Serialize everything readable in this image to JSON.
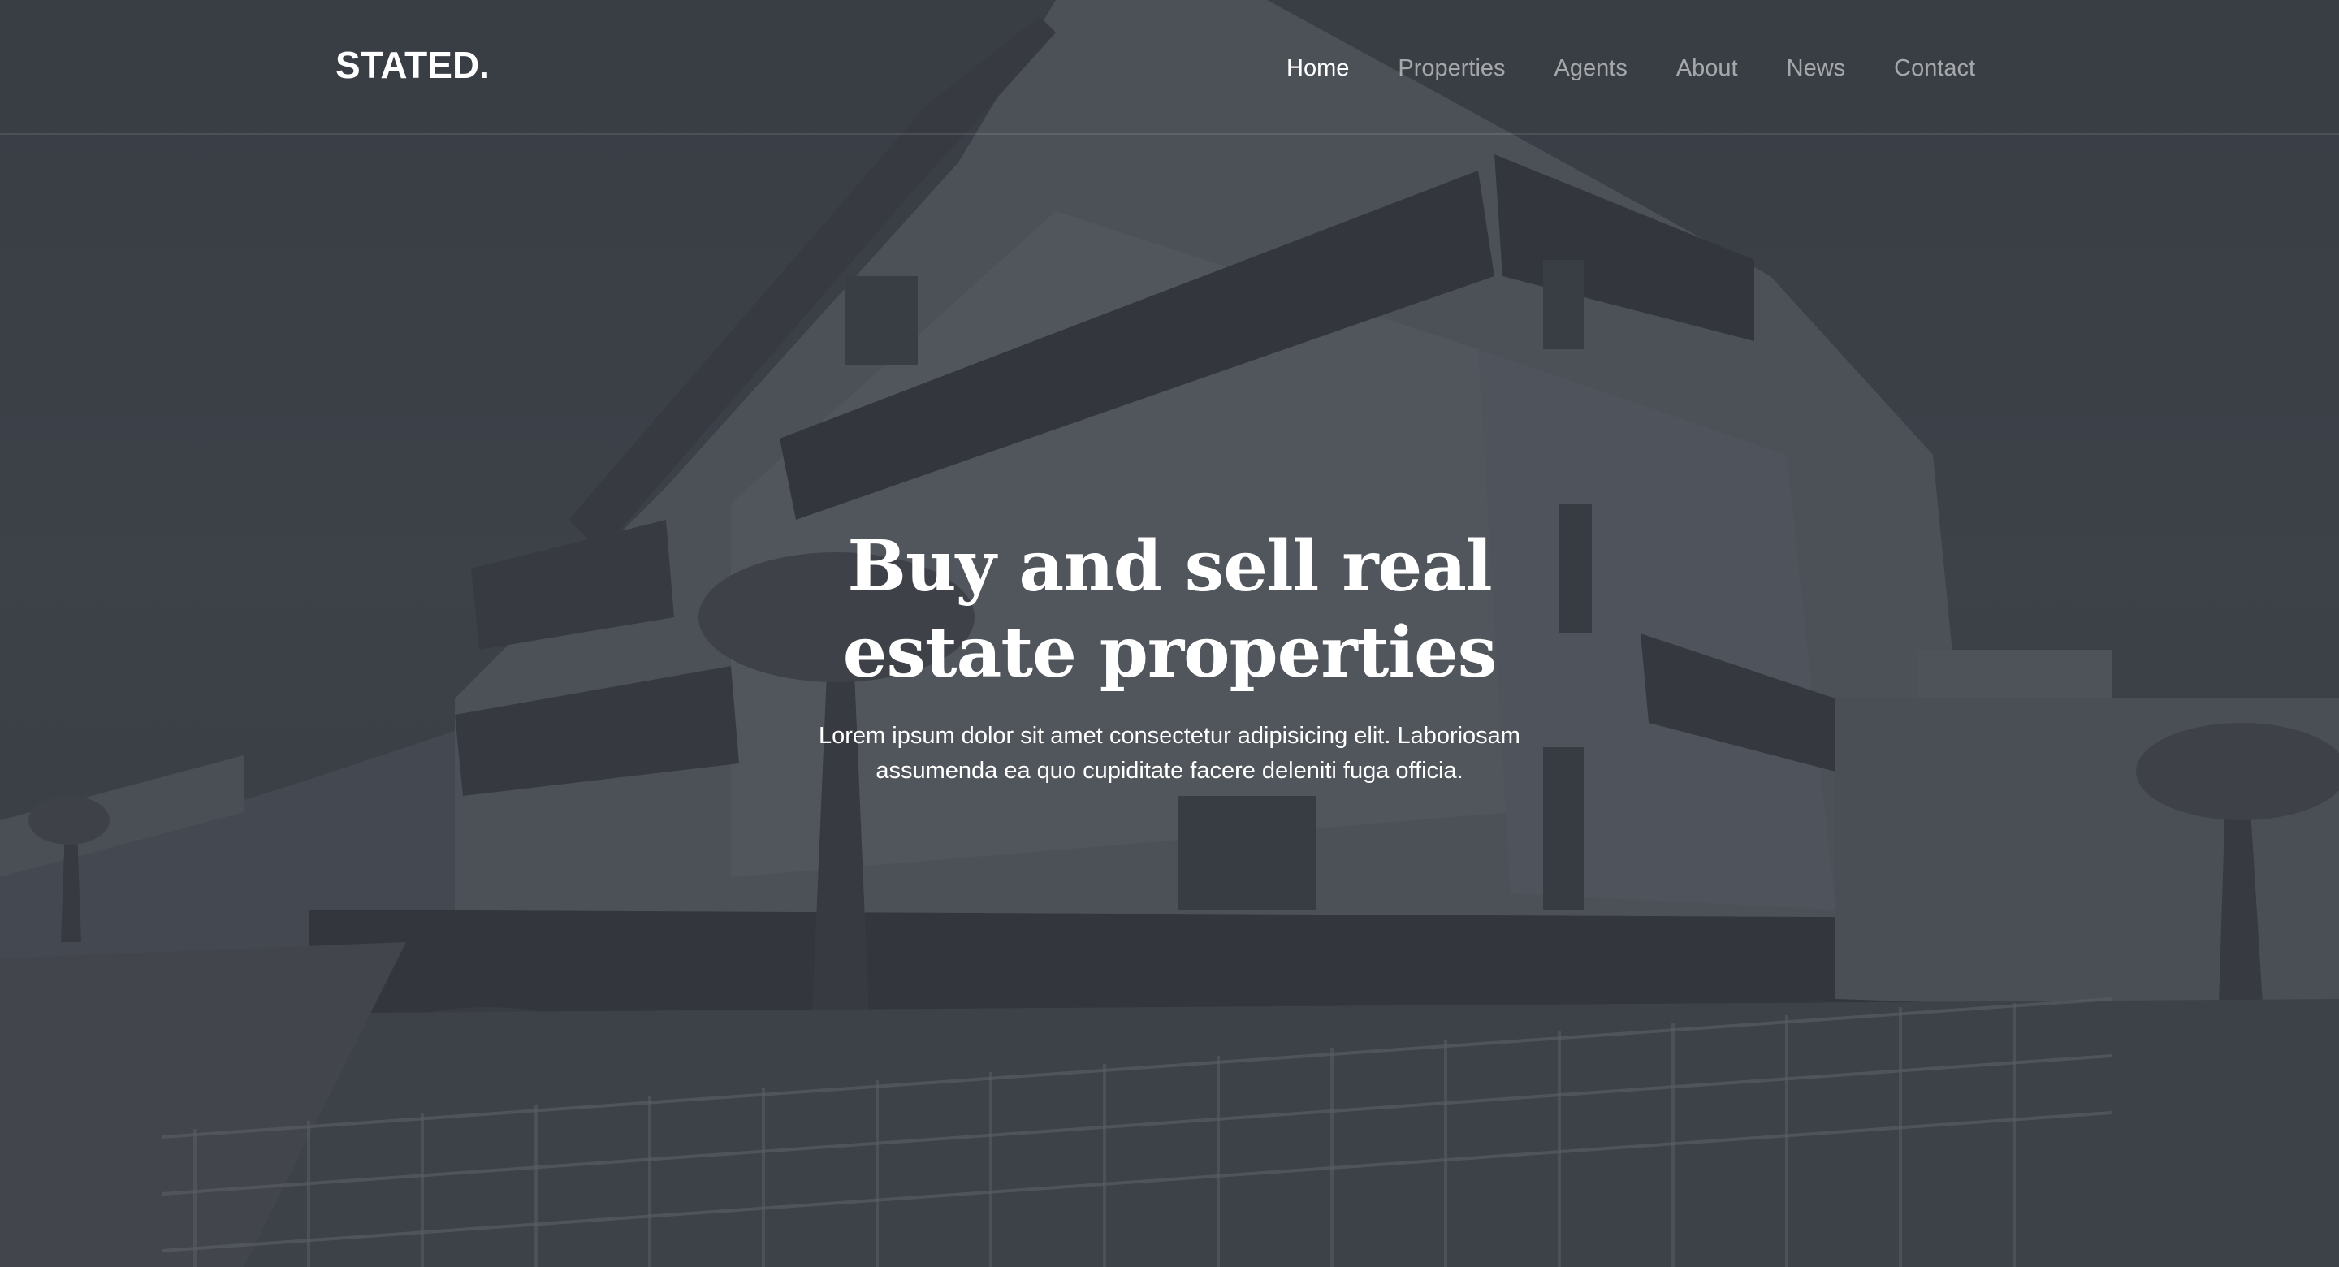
{
  "brand": {
    "logo": "STATED."
  },
  "nav": {
    "items": [
      {
        "label": "Home",
        "active": true
      },
      {
        "label": "Properties",
        "active": false
      },
      {
        "label": "Agents",
        "active": false
      },
      {
        "label": "About",
        "active": false
      },
      {
        "label": "News",
        "active": false
      },
      {
        "label": "Contact",
        "active": false
      }
    ]
  },
  "hero": {
    "title": "Buy and sell real estate properties",
    "subtitle": "Lorem ipsum dolor sit amet consectetur adipisicing elit. Laboriosam assumenda ea quo cupiditate facere deleniti fuga officia.",
    "background_image": "apartment-building-photo"
  },
  "colors": {
    "overlay": "#3a3e45",
    "text_primary": "#ffffff",
    "nav_inactive": "#a3a6ab"
  }
}
